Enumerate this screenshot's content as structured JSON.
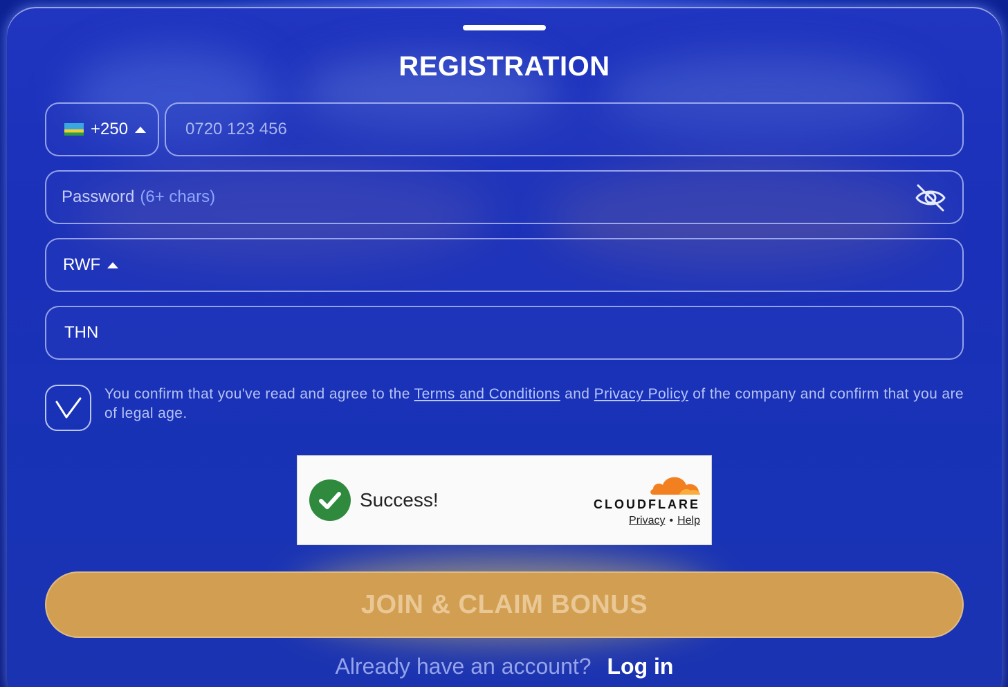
{
  "modal": {
    "title": "REGISTRATION"
  },
  "phone": {
    "country_code": "+250",
    "flag": "rwanda-flag",
    "placeholder": "0720 123 456"
  },
  "password": {
    "label": "Password",
    "hint": "(6+ chars)",
    "toggle_icon": "eye-slash-icon"
  },
  "currency": {
    "value": "RWF"
  },
  "promo": {
    "value": "THN"
  },
  "agreement": {
    "checked": true,
    "text_before": "You confirm that you've read and agree to the",
    "terms_link": "Terms and Conditions",
    "text_and": "and",
    "privacy_link": "Privacy Policy",
    "text_after": "of the company and confirm that you are of legal age."
  },
  "captcha": {
    "status": "Success!",
    "brand": "CLOUDFLARE",
    "privacy_link": "Privacy",
    "separator": "•",
    "help_link": "Help"
  },
  "submit": {
    "label": "JOIN & CLAIM BONUS"
  },
  "footer": {
    "prompt": "Already have an account?",
    "login_label": "Log in"
  },
  "colors": {
    "background": "#1a30b8",
    "button": "#d29f52",
    "link": "#b8c6ff",
    "captcha_success": "#2f8a3e",
    "cloudflare_orange": "#f38020"
  }
}
